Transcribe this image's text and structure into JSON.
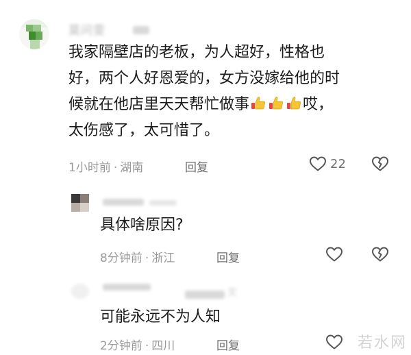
{
  "main_comment": {
    "author": "莫问雯",
    "text_line1": "我家隔壁店的老板，为人超好，性格也",
    "text_line2": "好，两个人好恩爱的，女方没嫁给他的时",
    "text_line3_pre": "候就在他店里天天帮忙做事",
    "text_line3_post": "哎，",
    "text_line4": "太伤感了，太可惜了。",
    "thumb_emoji_icons": [
      "thumbs-up-icon",
      "thumbs-up-icon",
      "thumbs-up-icon"
    ],
    "time": "1小时前",
    "separator": "·",
    "location": "湖南",
    "reply_label": "回复",
    "like_count": "22"
  },
  "reply1": {
    "text": "具体啥原因?",
    "time": "8分钟前",
    "separator": "·",
    "location": "浙江",
    "reply_label": "回复"
  },
  "reply2": {
    "author_partial": "文",
    "text": "可能永远不为人知",
    "time": "2分钟前",
    "separator": "·",
    "location": "四川",
    "reply_label": "回复"
  },
  "watermark": "若水网",
  "colors": {
    "text": "#1a1a1a",
    "meta": "#9a9a9a",
    "icon_stroke": "#555555",
    "thumb_yellow": "#f6c533",
    "thumb_red": "#e8453c"
  }
}
